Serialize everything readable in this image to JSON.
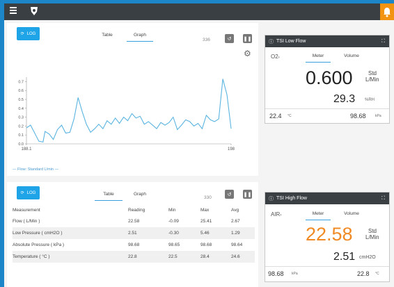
{
  "header": {
    "menu_icon": "hamburger-icon",
    "logo_icon": "tsi-logo-icon",
    "notification_icon": "bell-icon",
    "accent": "#f29411"
  },
  "graph_panel": {
    "log_label": "LOG",
    "tabs": [
      "Table",
      "Graph"
    ],
    "count": "336",
    "legend": "— Flow: Standard L/min —"
  },
  "table_panel": {
    "log_label": "LOG",
    "tabs": [
      "Table",
      "Graph"
    ],
    "count": "330",
    "columns": [
      "Measurement",
      "Reading",
      "Min",
      "Max",
      "Avg"
    ],
    "rows": [
      [
        "Flow ( L/Min )",
        "22.58",
        "-0.09",
        "25.41",
        "2.67"
      ],
      [
        "Low Pressure ( cmH2O )",
        "2.51",
        "-0.30",
        "5.46",
        "1.29"
      ],
      [
        "Absolute Pressure ( kPa )",
        "98.68",
        "98.65",
        "98.68",
        "98.64"
      ],
      [
        "Temperature ( °C )",
        "22.8",
        "22.5",
        "28.4",
        "24.6"
      ]
    ]
  },
  "low_flow_card": {
    "title": "TSI Low Flow",
    "gas": "O2",
    "tabs": [
      "Meter",
      "Volume"
    ],
    "main_value": "0.600",
    "main_unit_top": "Std",
    "main_unit_bottom": "L/Min",
    "secondary_value": "29.3",
    "secondary_unit": "%RH",
    "temp_value": "22.4",
    "temp_unit": "°C",
    "pressure_value": "98.68",
    "pressure_unit": "kPa"
  },
  "high_flow_card": {
    "title": "TSI High Flow",
    "gas": "AIR",
    "tabs": [
      "Meter",
      "Volume"
    ],
    "main_value": "22.58",
    "main_unit_top": "Std",
    "main_unit_bottom": "L/Min",
    "main_color": "#f08a24",
    "secondary_value": "2.51",
    "secondary_unit": "cmH2O",
    "pressure_value": "98.68",
    "pressure_unit": "kPa",
    "temp_value": "22.8",
    "temp_unit": "°C"
  },
  "chart_data": {
    "type": "line",
    "x_ticks": [
      "188.1",
      "198"
    ],
    "y_ticks": [
      "0.7",
      "0.6",
      "0.5",
      "0.4",
      "0.3",
      "0.2",
      "0.1",
      "0.0"
    ],
    "ylim": [
      0,
      0.75
    ],
    "xlim": [
      188.1,
      198
    ],
    "series": [
      {
        "name": "Flow: Standard L/min",
        "color": "#5ab4e0",
        "x": [
          188.1,
          188.3,
          188.5,
          188.7,
          188.9,
          189.0,
          189.2,
          189.4,
          189.6,
          189.8,
          190.0,
          190.2,
          190.4,
          190.6,
          190.8,
          191.0,
          191.2,
          191.4,
          191.6,
          191.8,
          192.0,
          192.2,
          192.4,
          192.6,
          192.8,
          193.0,
          193.2,
          193.4,
          193.6,
          193.8,
          194.0,
          194.2,
          194.4,
          194.6,
          194.8,
          195.0,
          195.2,
          195.4,
          195.6,
          195.8,
          196.0,
          196.2,
          196.4,
          196.6,
          196.8,
          197.0,
          197.2,
          197.4,
          197.6,
          197.8,
          198.0
        ],
        "y": [
          0.18,
          0.21,
          0.12,
          0.03,
          0.02,
          0.14,
          0.11,
          0.05,
          0.16,
          0.21,
          0.12,
          0.13,
          0.28,
          0.52,
          0.36,
          0.22,
          0.13,
          0.17,
          0.22,
          0.17,
          0.26,
          0.22,
          0.29,
          0.23,
          0.3,
          0.26,
          0.34,
          0.29,
          0.31,
          0.22,
          0.25,
          0.21,
          0.17,
          0.24,
          0.21,
          0.24,
          0.3,
          0.16,
          0.21,
          0.27,
          0.25,
          0.2,
          0.23,
          0.17,
          0.32,
          0.27,
          0.25,
          0.28,
          0.73,
          0.55,
          0.17
        ]
      }
    ]
  }
}
